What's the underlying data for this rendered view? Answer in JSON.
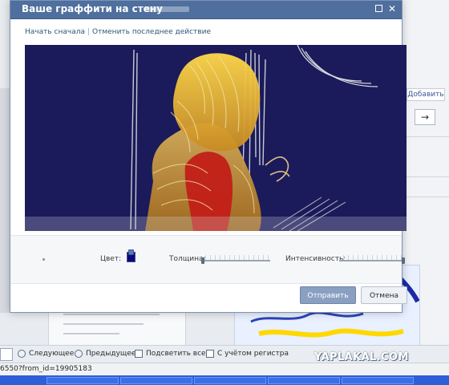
{
  "modal": {
    "title": "Ваше граффити на стену",
    "actions": {
      "start_over": "Начать сначала",
      "undo_last": "Отменить последнее действие"
    }
  },
  "toolbar": {
    "color_label": "Цвет:",
    "color_value": "#0b0b7a",
    "thickness_label": "Толщина:",
    "thickness_value": 0.0,
    "intensity_label": "Интенсивность:",
    "intensity_value": 1.0
  },
  "buttons": {
    "send": "Отправить",
    "cancel": "Отмена"
  },
  "background": {
    "tab_add": "Добавить",
    "arrow": "→"
  },
  "findbar": {
    "next": "Следующее",
    "previous": "Предыдущее",
    "highlight_all": "Подсветить все",
    "match_case": "С учётом регистра"
  },
  "status": {
    "url": "6550?from_id=19905183"
  },
  "watermark": "YAPLAKAL.COM",
  "colors": {
    "titlebar": "#4f6f9e",
    "canvas": "#1b1b5b",
    "send_button": "#8aa0c2"
  }
}
